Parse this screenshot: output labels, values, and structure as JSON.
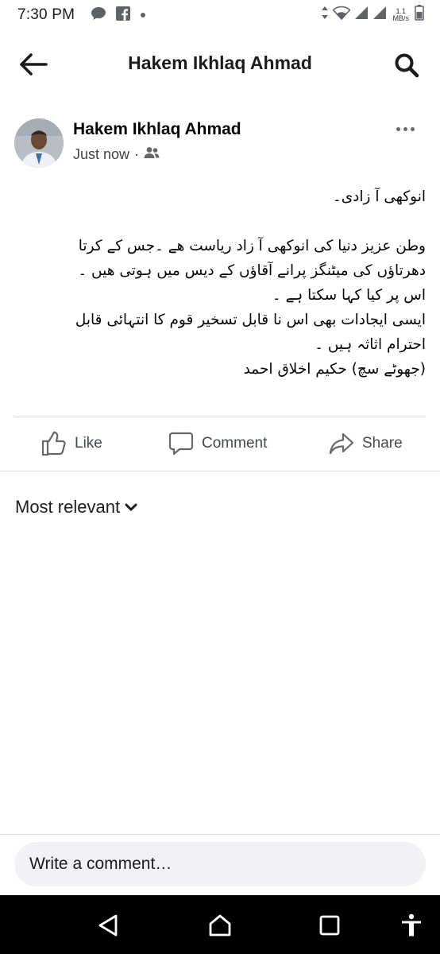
{
  "status_bar": {
    "time": "7:30 PM",
    "net_speed_value": "1.1",
    "net_speed_unit": "MB/s",
    "icons": [
      "chat-bubble-icon",
      "facebook-icon",
      "dot-icon",
      "data-arrows-icon",
      "wifi-icon",
      "signal-icon",
      "signal-icon",
      "battery-icon"
    ]
  },
  "header": {
    "title": "Hakem Ikhlaq Ahmad",
    "back_icon": "arrow-left-icon",
    "search_icon": "search-icon"
  },
  "post": {
    "author": "Hakem Ikhlaq Ahmad",
    "timestamp": "Just now",
    "separator": "·",
    "audience_icon": "friends-icon",
    "paragraphs": [
      "انوکھی آ زادی۔",
      "",
      "وطن عزیز دنیا کی انوکھی آ زاد ریاست ھے ۔جس کے کرتا",
      "دھرتاؤں کی میٹنگز پرانے آقاؤں کے دیس میں ہوتی ھیں ۔",
      "اس پر کیا کہا سکتا ہے ۔",
      "ایسی ایجادات بھی اس نا قابل تسخیر قوم کا انتہائی قابل",
      "احترام اثاثہ ہیں ۔",
      "(جھوٹے سچ) حکیم اخلاق احمد"
    ]
  },
  "actions": {
    "like": "Like",
    "comment": "Comment",
    "share": "Share"
  },
  "comments": {
    "sort_label": "Most relevant",
    "input_placeholder": "Write a comment…"
  },
  "colors": {
    "icon_gray": "#65676b",
    "text_dark": "#050505",
    "divider": "#d9dadc",
    "input_bg": "#f0f2f5",
    "nav_bg": "#000000"
  }
}
